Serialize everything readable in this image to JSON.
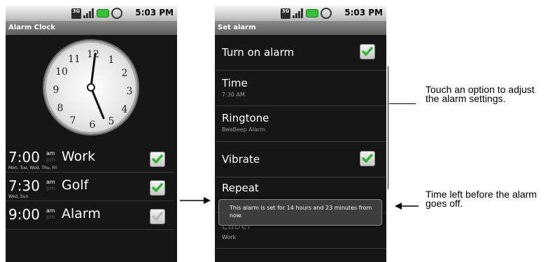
{
  "status_bar": {
    "time": "5:03 PM",
    "network": "3G"
  },
  "alarm_clock_screen": {
    "title": "Alarm Clock",
    "clock_numerals": [
      "12",
      "1",
      "2",
      "3",
      "4",
      "5",
      "6",
      "7",
      "8",
      "9",
      "10",
      "11"
    ],
    "alarms": [
      {
        "time": "7:00",
        "am": "am",
        "pm": "pm",
        "name": "Work",
        "days": "Mon, Tue, Wed, Thu, Fri",
        "enabled": true
      },
      {
        "time": "7:30",
        "am": "am",
        "pm": "pm",
        "name": "Golf",
        "days": "Wed, Sun",
        "enabled": true
      },
      {
        "time": "9:00",
        "am": "am",
        "pm": "pm",
        "name": "Alarm",
        "days": "",
        "enabled": false
      }
    ]
  },
  "set_alarm_screen": {
    "title": "Set alarm",
    "turn_on_alarm": "Turn on alarm",
    "time_label": "Time",
    "time_value": "7:30 AM",
    "ringtone_label": "Ringtone",
    "ringtone_value": "BeeBeep Alarm",
    "vibrate_label": "Vibrate",
    "repeat_label": "Repeat",
    "label_label": "Label",
    "label_value": "Work",
    "toast": "This alarm is set for 14 hours and 23 minutes from now."
  },
  "annotations": {
    "options": "Touch an option to adjust the alarm settings.",
    "time_left": "Time left before the alarm goes off."
  },
  "colors": {
    "check_green": "#2eb82e",
    "background": "#161616"
  }
}
